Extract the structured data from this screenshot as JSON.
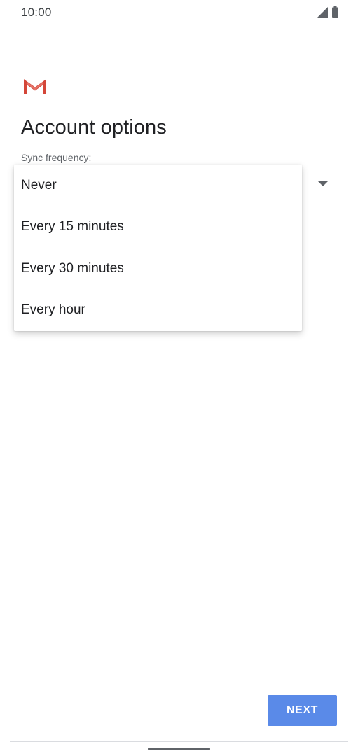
{
  "status_bar": {
    "time": "10:00",
    "signal_icon": "cellular-signal-icon",
    "battery_icon": "battery-icon"
  },
  "app": {
    "logo_icon": "gmail-icon",
    "logo_colors": [
      "#c5221f",
      "#ea4335",
      "#e57373"
    ]
  },
  "page": {
    "title": "Account options",
    "sync_label": "Sync frequency:"
  },
  "dropdown": {
    "options": [
      {
        "label": "Never"
      },
      {
        "label": "Every 15 minutes"
      },
      {
        "label": "Every 30 minutes"
      },
      {
        "label": "Every hour"
      }
    ],
    "arrow_icon": "dropdown-arrow-icon"
  },
  "footer": {
    "next_label": "NEXT",
    "accent_color": "#5a8ae8"
  }
}
